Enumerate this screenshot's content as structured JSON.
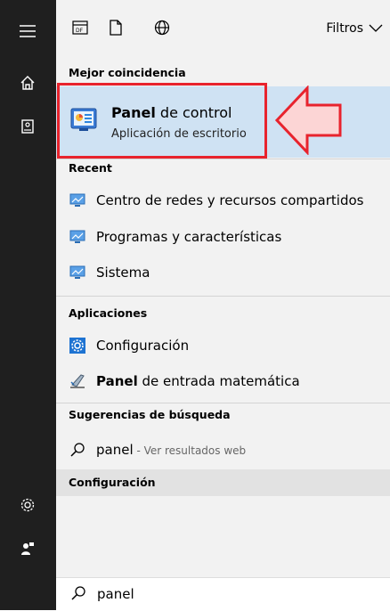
{
  "toolbar": {
    "icons": [
      "document-list-icon",
      "blank-document-icon",
      "globe-icon"
    ],
    "filters_label": "Filtros"
  },
  "best_match": {
    "header": "Mejor coincidencia",
    "title_bold": "Panel",
    "title_rest": " de control",
    "subtitle": "Aplicación de escritorio"
  },
  "recent": {
    "header": "Recent",
    "items": [
      {
        "label": "Centro de redes y recursos compartidos"
      },
      {
        "label": "Programas y características"
      },
      {
        "label": "Sistema"
      }
    ]
  },
  "apps": {
    "header": "Aplicaciones",
    "items": [
      {
        "label_bold": "",
        "label_rest": "Configuración"
      },
      {
        "label_bold": "Panel",
        "label_rest": " de entrada matemática"
      }
    ]
  },
  "suggestions": {
    "header": "Sugerencias de búsqueda",
    "query": "panel",
    "hint": " - Ver resultados web"
  },
  "settings_section": {
    "header": "Configuración"
  },
  "search_box": {
    "value": "panel"
  },
  "colors": {
    "rail": "#1f1f1f",
    "highlight": "#cfe2f3",
    "annotation_red": "#e8232d"
  }
}
